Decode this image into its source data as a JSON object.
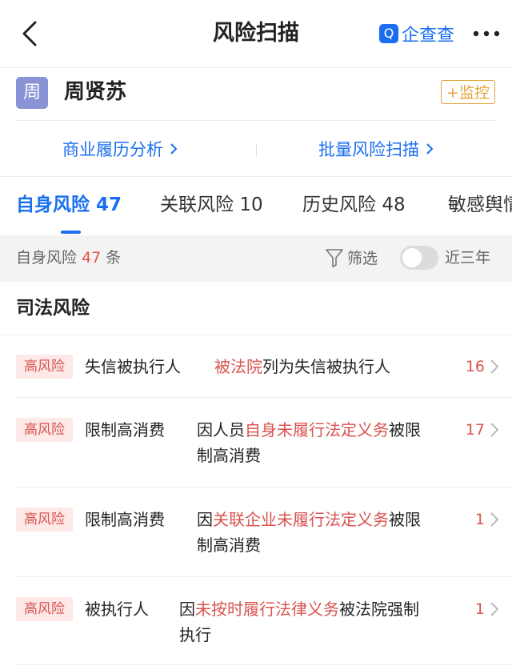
{
  "nav": {
    "title": "风险扫描",
    "brand_logo": "Q",
    "brand": "企查查"
  },
  "person": {
    "avatar": "周",
    "name": "周贤苏",
    "watch": "+监控"
  },
  "links": {
    "left": "商业履历分析",
    "right": "批量风险扫描"
  },
  "tabs": [
    {
      "label": "自身风险",
      "count": "47"
    },
    {
      "label": "关联风险",
      "count": "10"
    },
    {
      "label": "历史风险",
      "count": "48"
    },
    {
      "label": "敏感舆情",
      "count": ""
    }
  ],
  "filterbar": {
    "prefix": "自身风险",
    "count": "47",
    "suffix": "条",
    "filter": "筛选",
    "toggle_label": "近三年"
  },
  "section": "司法风险",
  "rows": [
    {
      "tag": "高风险",
      "type": "失信被执行人",
      "pre": "",
      "highlight": "被法院",
      "post": "列为失信被执行人",
      "count": "16"
    },
    {
      "tag": "高风险",
      "type": "限制高消费",
      "pre": "因人员",
      "highlight": "自身未履行法定义务",
      "post": "被限制高消费",
      "count": "17"
    },
    {
      "tag": "高风险",
      "type": "限制高消费",
      "pre": "因",
      "highlight": "关联企业未履行法定义务",
      "post": "被限制高消费",
      "count": "1"
    },
    {
      "tag": "高风险",
      "type": "被执行人",
      "pre": "因",
      "highlight": "未按时履行法律义务",
      "post": "被法院强制执行",
      "count": "1"
    }
  ],
  "colors": {
    "accent": "#1a6ff0",
    "risk": "#d9534f",
    "watch": "#e3a43a"
  }
}
